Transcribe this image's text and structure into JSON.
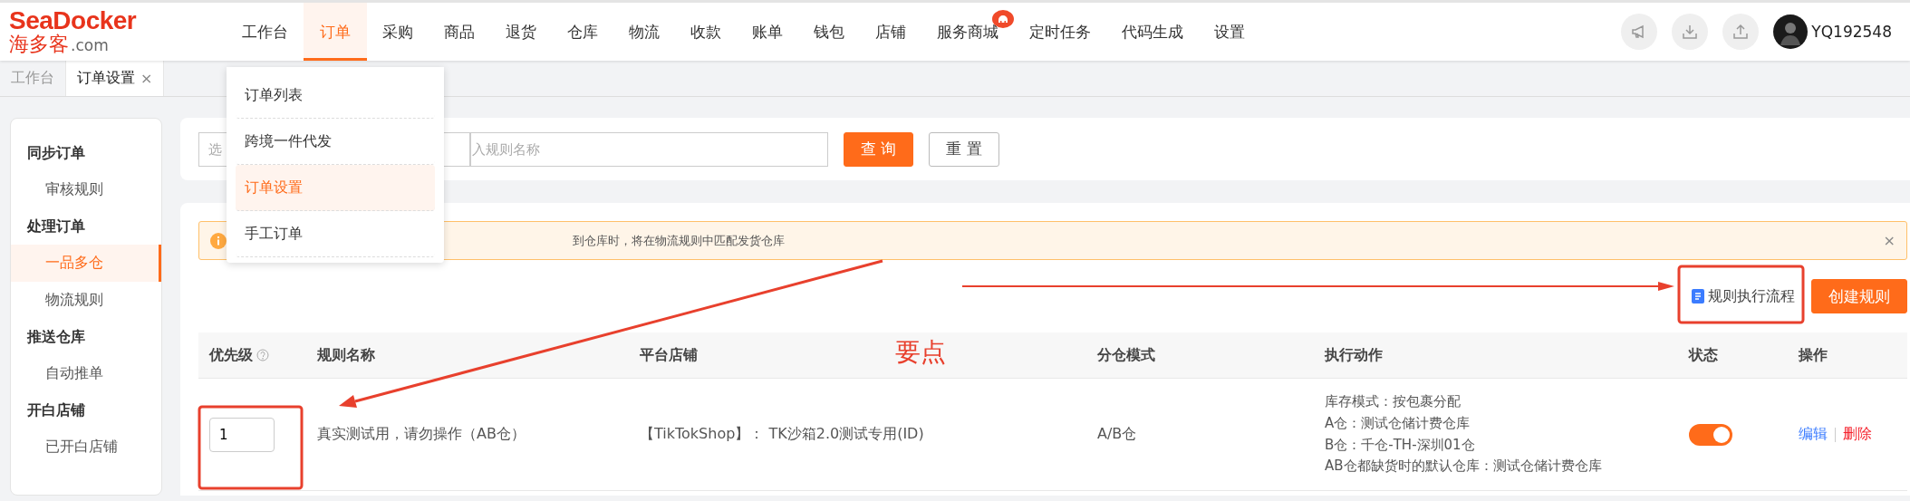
{
  "logo": {
    "brand": "SeaDocker",
    "name": "海多客",
    "domain": ".com"
  },
  "nav": [
    {
      "label": "工作台",
      "selected": false,
      "badge": false
    },
    {
      "label": "订单",
      "selected": true,
      "badge": false
    },
    {
      "label": "采购",
      "selected": false,
      "badge": false
    },
    {
      "label": "商品",
      "selected": false,
      "badge": false
    },
    {
      "label": "退货",
      "selected": false,
      "badge": false
    },
    {
      "label": "仓库",
      "selected": false,
      "badge": false
    },
    {
      "label": "物流",
      "selected": false,
      "badge": false
    },
    {
      "label": "收款",
      "selected": false,
      "badge": false
    },
    {
      "label": "账单",
      "selected": false,
      "badge": false
    },
    {
      "label": "钱包",
      "selected": false,
      "badge": false
    },
    {
      "label": "店铺",
      "selected": false,
      "badge": false
    },
    {
      "label": "服务商城",
      "selected": false,
      "badge": true
    },
    {
      "label": "定时任务",
      "selected": false,
      "badge": false
    },
    {
      "label": "代码生成",
      "selected": false,
      "badge": false
    },
    {
      "label": "设置",
      "selected": false,
      "badge": false
    }
  ],
  "user": {
    "name": "YQ192548"
  },
  "tabs": [
    {
      "label": "工作台",
      "selected": false
    },
    {
      "label": "订单设置",
      "selected": true,
      "close": "×"
    }
  ],
  "dropdown": [
    {
      "label": "订单列表",
      "selected": false
    },
    {
      "label": "跨境一件代发",
      "selected": false
    },
    {
      "label": "订单设置",
      "selected": true
    },
    {
      "label": "手工订单",
      "selected": false
    }
  ],
  "sidebar": [
    {
      "title": "同步订单",
      "children": [
        {
          "label": "审核规则",
          "selected": false
        }
      ]
    },
    {
      "title": "处理订单",
      "children": [
        {
          "label": "一品多仓",
          "selected": true
        },
        {
          "label": "物流规则",
          "selected": false
        }
      ]
    },
    {
      "title": "推送仓库",
      "children": [
        {
          "label": "自动推单",
          "selected": false
        }
      ]
    },
    {
      "title": "开白店铺",
      "children": [
        {
          "label": "已开白店铺",
          "selected": false
        }
      ]
    }
  ],
  "search": {
    "select_placeholder": "选",
    "input_placeholder": "入规则名称",
    "query_button": "查 询",
    "reset_button": "重 置"
  },
  "alert": {
    "text": "到仓库时，将在物流规则中匹配发货仓库",
    "close": "×"
  },
  "actions": {
    "flow_link": "规则执行流程",
    "create_button": "创建规则"
  },
  "table": {
    "columns": [
      {
        "label": "优先级",
        "help": true
      },
      {
        "label": "规则名称",
        "help": false
      },
      {
        "label": "平台店铺",
        "help": false
      },
      {
        "label": "分仓模式",
        "help": false
      },
      {
        "label": "执行动作",
        "help": false
      },
      {
        "label": "状态",
        "help": false
      },
      {
        "label": "操作",
        "help": false
      }
    ],
    "rows": [
      {
        "priority": "1",
        "name": "真实测试用，请勿操作（AB仓）",
        "store": "【TikTokShop】： TK沙箱2.0测试专用(ID)",
        "mode": "A/B仓",
        "actions": [
          "库存模式：按包裹分配",
          "A仓：测试仓储计费仓库",
          "B仓：千仓-TH-深圳01仓",
          "AB仓都缺货时的默认仓库：测试仓储计费仓库"
        ],
        "enabled": true,
        "edit": "编辑",
        "delete": "删除"
      }
    ]
  },
  "annotation": {
    "label": "要点"
  }
}
